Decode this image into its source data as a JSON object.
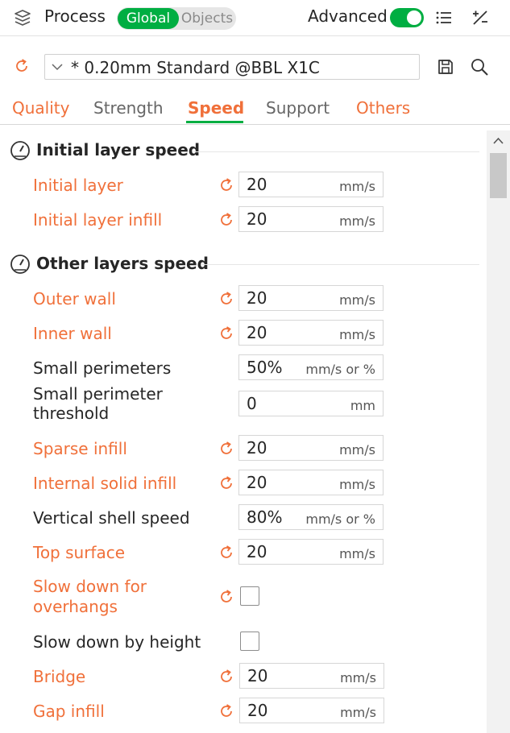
{
  "header": {
    "title": "Process",
    "mode_active": "Global",
    "mode_inactive": "Objects",
    "advanced_label": "Advanced",
    "advanced_on": true
  },
  "preset": {
    "name": "* 0.20mm Standard @BBL X1C"
  },
  "tabs": [
    {
      "label": "Quality",
      "active": false
    },
    {
      "label": "Strength",
      "active": false
    },
    {
      "label": "Speed",
      "active": true
    },
    {
      "label": "Support",
      "active": false
    },
    {
      "label": "Others",
      "active": false
    }
  ],
  "sections": [
    {
      "title": "Initial layer speed",
      "rows": [
        {
          "label": "Initial layer",
          "modified": true,
          "value": "20",
          "unit": "mm/s"
        },
        {
          "label": "Initial layer infill",
          "modified": true,
          "value": "20",
          "unit": "mm/s"
        }
      ]
    },
    {
      "title": "Other layers speed",
      "rows": [
        {
          "label": "Outer wall",
          "modified": true,
          "value": "20",
          "unit": "mm/s"
        },
        {
          "label": "Inner wall",
          "modified": true,
          "value": "20",
          "unit": "mm/s"
        },
        {
          "label": "Small perimeters",
          "modified": false,
          "value": "50%",
          "unit": "mm/s or %"
        },
        {
          "label_line1": "Small perimeter",
          "label_line2": "threshold",
          "modified": false,
          "value": "0",
          "unit": "mm"
        },
        {
          "label": "Sparse infill",
          "modified": true,
          "value": "20",
          "unit": "mm/s"
        },
        {
          "label": "Internal solid infill",
          "modified": true,
          "value": "20",
          "unit": "mm/s"
        },
        {
          "label": "Vertical shell speed",
          "modified": false,
          "value": "80%",
          "unit": "mm/s or %"
        },
        {
          "label": "Top surface",
          "modified": true,
          "value": "20",
          "unit": "mm/s"
        },
        {
          "label_line1": "Slow down for",
          "label_line2": "overhangs",
          "modified": true,
          "checked": false
        },
        {
          "label": "Slow down by height",
          "modified": false,
          "checked": false
        },
        {
          "label": "Bridge",
          "modified": true,
          "value": "20",
          "unit": "mm/s"
        },
        {
          "label": "Gap infill",
          "modified": true,
          "value": "20",
          "unit": "mm/s"
        }
      ]
    }
  ],
  "colors": {
    "accent_green": "#00ae42",
    "modified_orange": "#f0703a"
  },
  "icons": [
    "layers-icon",
    "list-icon",
    "compare-icon",
    "reset-icon",
    "chevron-down-icon",
    "save-icon",
    "search-icon",
    "speedometer-icon",
    "scroll-up-icon"
  ]
}
